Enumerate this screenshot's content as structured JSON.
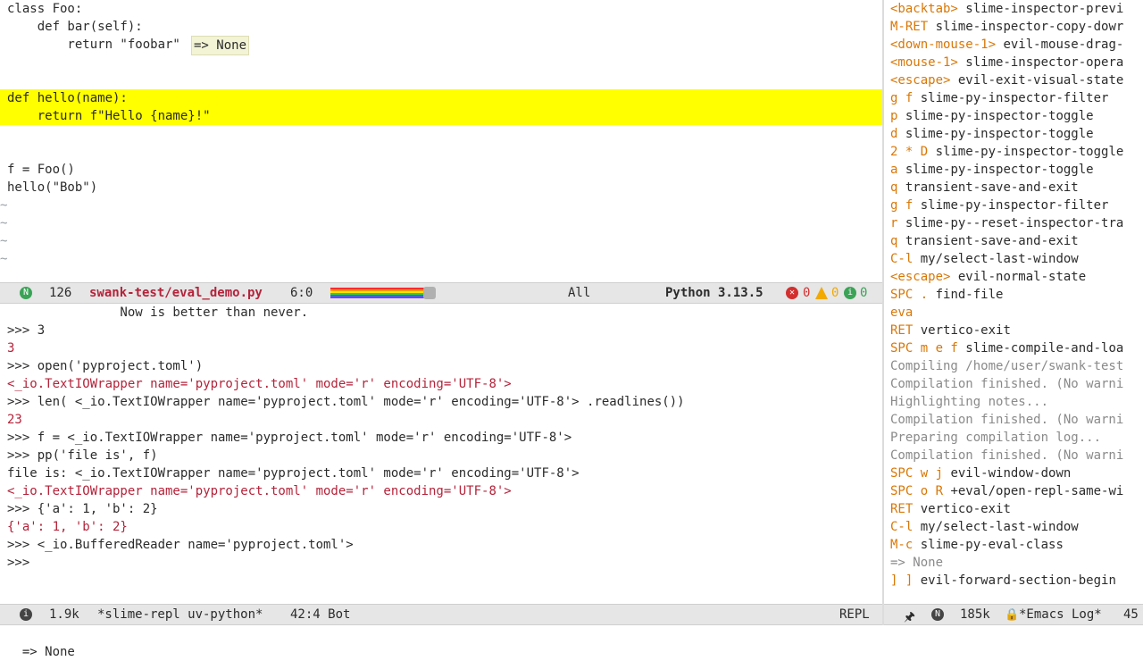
{
  "editor": {
    "lines": [
      {
        "code": "class Foo:"
      },
      {
        "code": "    def bar(self):"
      },
      {
        "code": "        return \"foobar\""
      },
      {
        "code": ""
      },
      {
        "code": ""
      },
      {
        "code": "def hello(name):"
      },
      {
        "code": "    return f\"Hello {name}!\""
      },
      {
        "code": ""
      },
      {
        "code": ""
      },
      {
        "code": "f = Foo()"
      },
      {
        "code": "hello(\"Bob\")"
      },
      {
        "code": "~"
      },
      {
        "code": "~"
      },
      {
        "code": "~"
      },
      {
        "code": "~"
      }
    ],
    "inline_result": "=> None",
    "highlighted_start": 5,
    "highlighted_end": 6
  },
  "editor_modeline": {
    "state_letter": "N",
    "line_count": "126",
    "file": "swank-test/eval_demo.py",
    "position": "6:0",
    "scroll": "All",
    "language": "Python 3.13.5",
    "errors": "0",
    "warnings": "0",
    "infos": "0"
  },
  "repl": {
    "lines": [
      {
        "text": "               Now is better than never.",
        "cls": ""
      },
      {
        "text": ">>> 3",
        "cls": ""
      },
      {
        "text": "3",
        "cls": "red"
      },
      {
        "text": ">>> open('pyproject.toml')",
        "cls": ""
      },
      {
        "text": "<_io.TextIOWrapper name='pyproject.toml' mode='r' encoding='UTF-8'>",
        "cls": "red"
      },
      {
        "text": ">>> len( <_io.TextIOWrapper name='pyproject.toml' mode='r' encoding='UTF-8'> .readlines())",
        "cls": ""
      },
      {
        "text": "23",
        "cls": "red"
      },
      {
        "text": ">>> f = <_io.TextIOWrapper name='pyproject.toml' mode='r' encoding='UTF-8'>",
        "cls": ""
      },
      {
        "text": ">>> pp('file is', f)",
        "cls": ""
      },
      {
        "text": "file is: <_io.TextIOWrapper name='pyproject.toml' mode='r' encoding='UTF-8'>",
        "cls": ""
      },
      {
        "text": "<_io.TextIOWrapper name='pyproject.toml' mode='r' encoding='UTF-8'>",
        "cls": "red"
      },
      {
        "text": ">>> {'a': 1, 'b': 2}",
        "cls": ""
      },
      {
        "text": "{'a': 1, 'b': 2}",
        "cls": "red"
      },
      {
        "text": ">>> <_io.BufferedReader name='pyproject.toml'>",
        "cls": ""
      },
      {
        "text": ">>>",
        "cls": ""
      }
    ]
  },
  "repl_modeline": {
    "size": "1.9k",
    "buffer": "*slime-repl uv-python*",
    "position": "42:4 Bot",
    "mode": "REPL"
  },
  "log": {
    "lines": [
      {
        "key": "<backtab>",
        "cmd": "slime-inspector-previ"
      },
      {
        "key": "M-RET",
        "cmd": "slime-inspector-copy-dowr"
      },
      {
        "key": "<down-mouse-1>",
        "cmd": "evil-mouse-drag-"
      },
      {
        "key": "<mouse-1>",
        "cmd": "slime-inspector-opera"
      },
      {
        "key": "<escape>",
        "cmd": "evil-exit-visual-state"
      },
      {
        "key": "g f",
        "cmd": "slime-py-inspector-filter"
      },
      {
        "key": "p",
        "cmd": "slime-py-inspector-toggle"
      },
      {
        "key": "d",
        "cmd": "slime-py-inspector-toggle"
      },
      {
        "key": "2 * D",
        "cmd": "slime-py-inspector-toggle"
      },
      {
        "key": "a",
        "cmd": "slime-py-inspector-toggle"
      },
      {
        "key": "q",
        "cmd": "transient-save-and-exit"
      },
      {
        "key": "g f",
        "cmd": "slime-py-inspector-filter"
      },
      {
        "key": "r",
        "cmd": "slime-py--reset-inspector-tra"
      },
      {
        "key": "q",
        "cmd": "transient-save-and-exit"
      },
      {
        "key": "C-l",
        "cmd": "my/select-last-window"
      },
      {
        "key": "<escape>",
        "cmd": "evil-normal-state"
      },
      {
        "key": "SPC .",
        "cmd": "find-file"
      },
      {
        "key": "eva",
        "cmd": ""
      },
      {
        "key": "RET",
        "cmd": "vertico-exit"
      },
      {
        "key": "SPC m e f",
        "cmd": "slime-compile-and-loa"
      },
      {
        "key": "",
        "cmd": "Compiling /home/user/swank-test"
      },
      {
        "key": "",
        "cmd": "Compilation finished. (No warni"
      },
      {
        "key": "",
        "cmd": "Highlighting notes..."
      },
      {
        "key": "",
        "cmd": "Compilation finished. (No warni"
      },
      {
        "key": "",
        "cmd": "Preparing compilation log..."
      },
      {
        "key": "",
        "cmd": "Compilation finished. (No warni"
      },
      {
        "key": "SPC w j",
        "cmd": "evil-window-down"
      },
      {
        "key": "SPC o R",
        "cmd": "+eval/open-repl-same-wi"
      },
      {
        "key": "RET",
        "cmd": "vertico-exit"
      },
      {
        "key": "C-l",
        "cmd": "my/select-last-window"
      },
      {
        "key": "M-c",
        "cmd": "slime-py-eval-class"
      },
      {
        "key": "",
        "cmd": "=> None"
      },
      {
        "key": "] ]",
        "cmd": "evil-forward-section-begin"
      }
    ]
  },
  "log_modeline": {
    "state_letter": "N",
    "size": "185k",
    "buffer": "*Emacs Log*",
    "position": "45"
  },
  "echo": "=> None"
}
